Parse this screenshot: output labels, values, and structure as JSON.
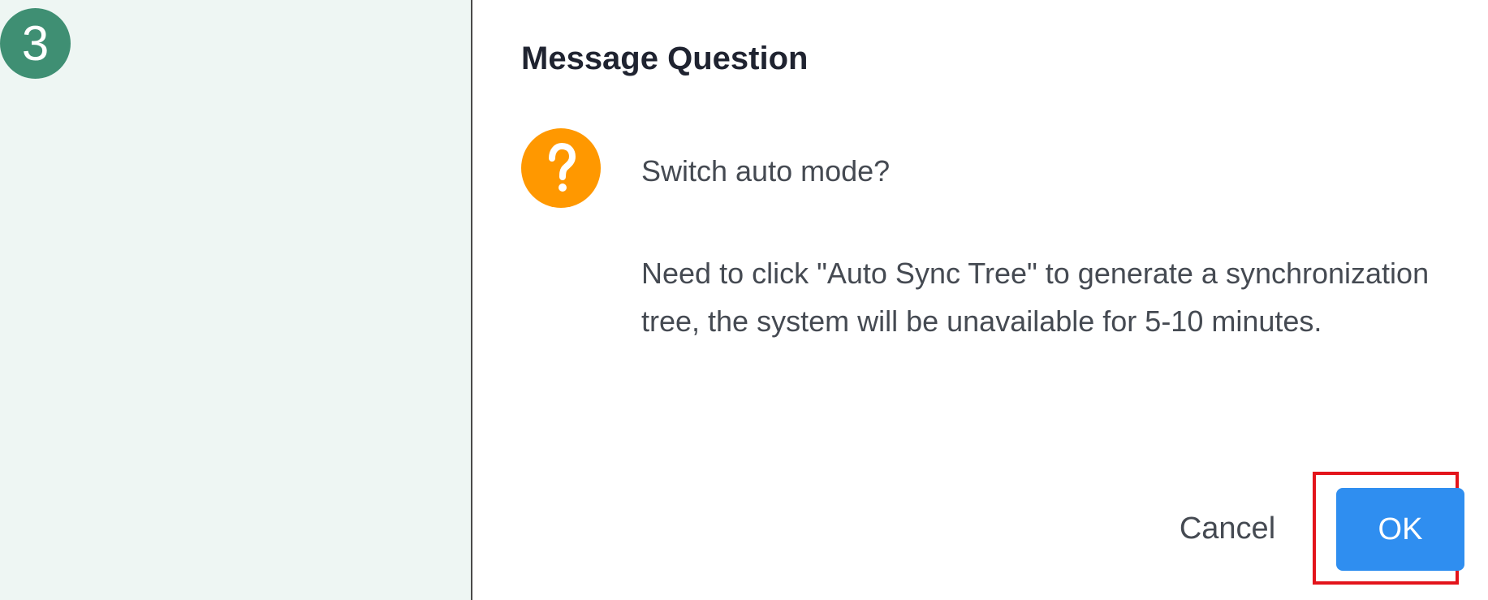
{
  "step": {
    "number": "3"
  },
  "dialog": {
    "title": "Message Question",
    "icon": "question-circle-icon",
    "message": "Switch auto mode?",
    "detail": "Need to click \"Auto Sync Tree\" to generate a synchronization tree, the system will be unavailable for 5-10 minutes.",
    "buttons": {
      "cancel_label": "Cancel",
      "ok_label": "OK"
    }
  },
  "colors": {
    "background": "#eef6f3",
    "step_badge": "#3f8f73",
    "icon": "#ff9800",
    "primary_button": "#2f8ef0",
    "highlight": "#e3141b"
  }
}
